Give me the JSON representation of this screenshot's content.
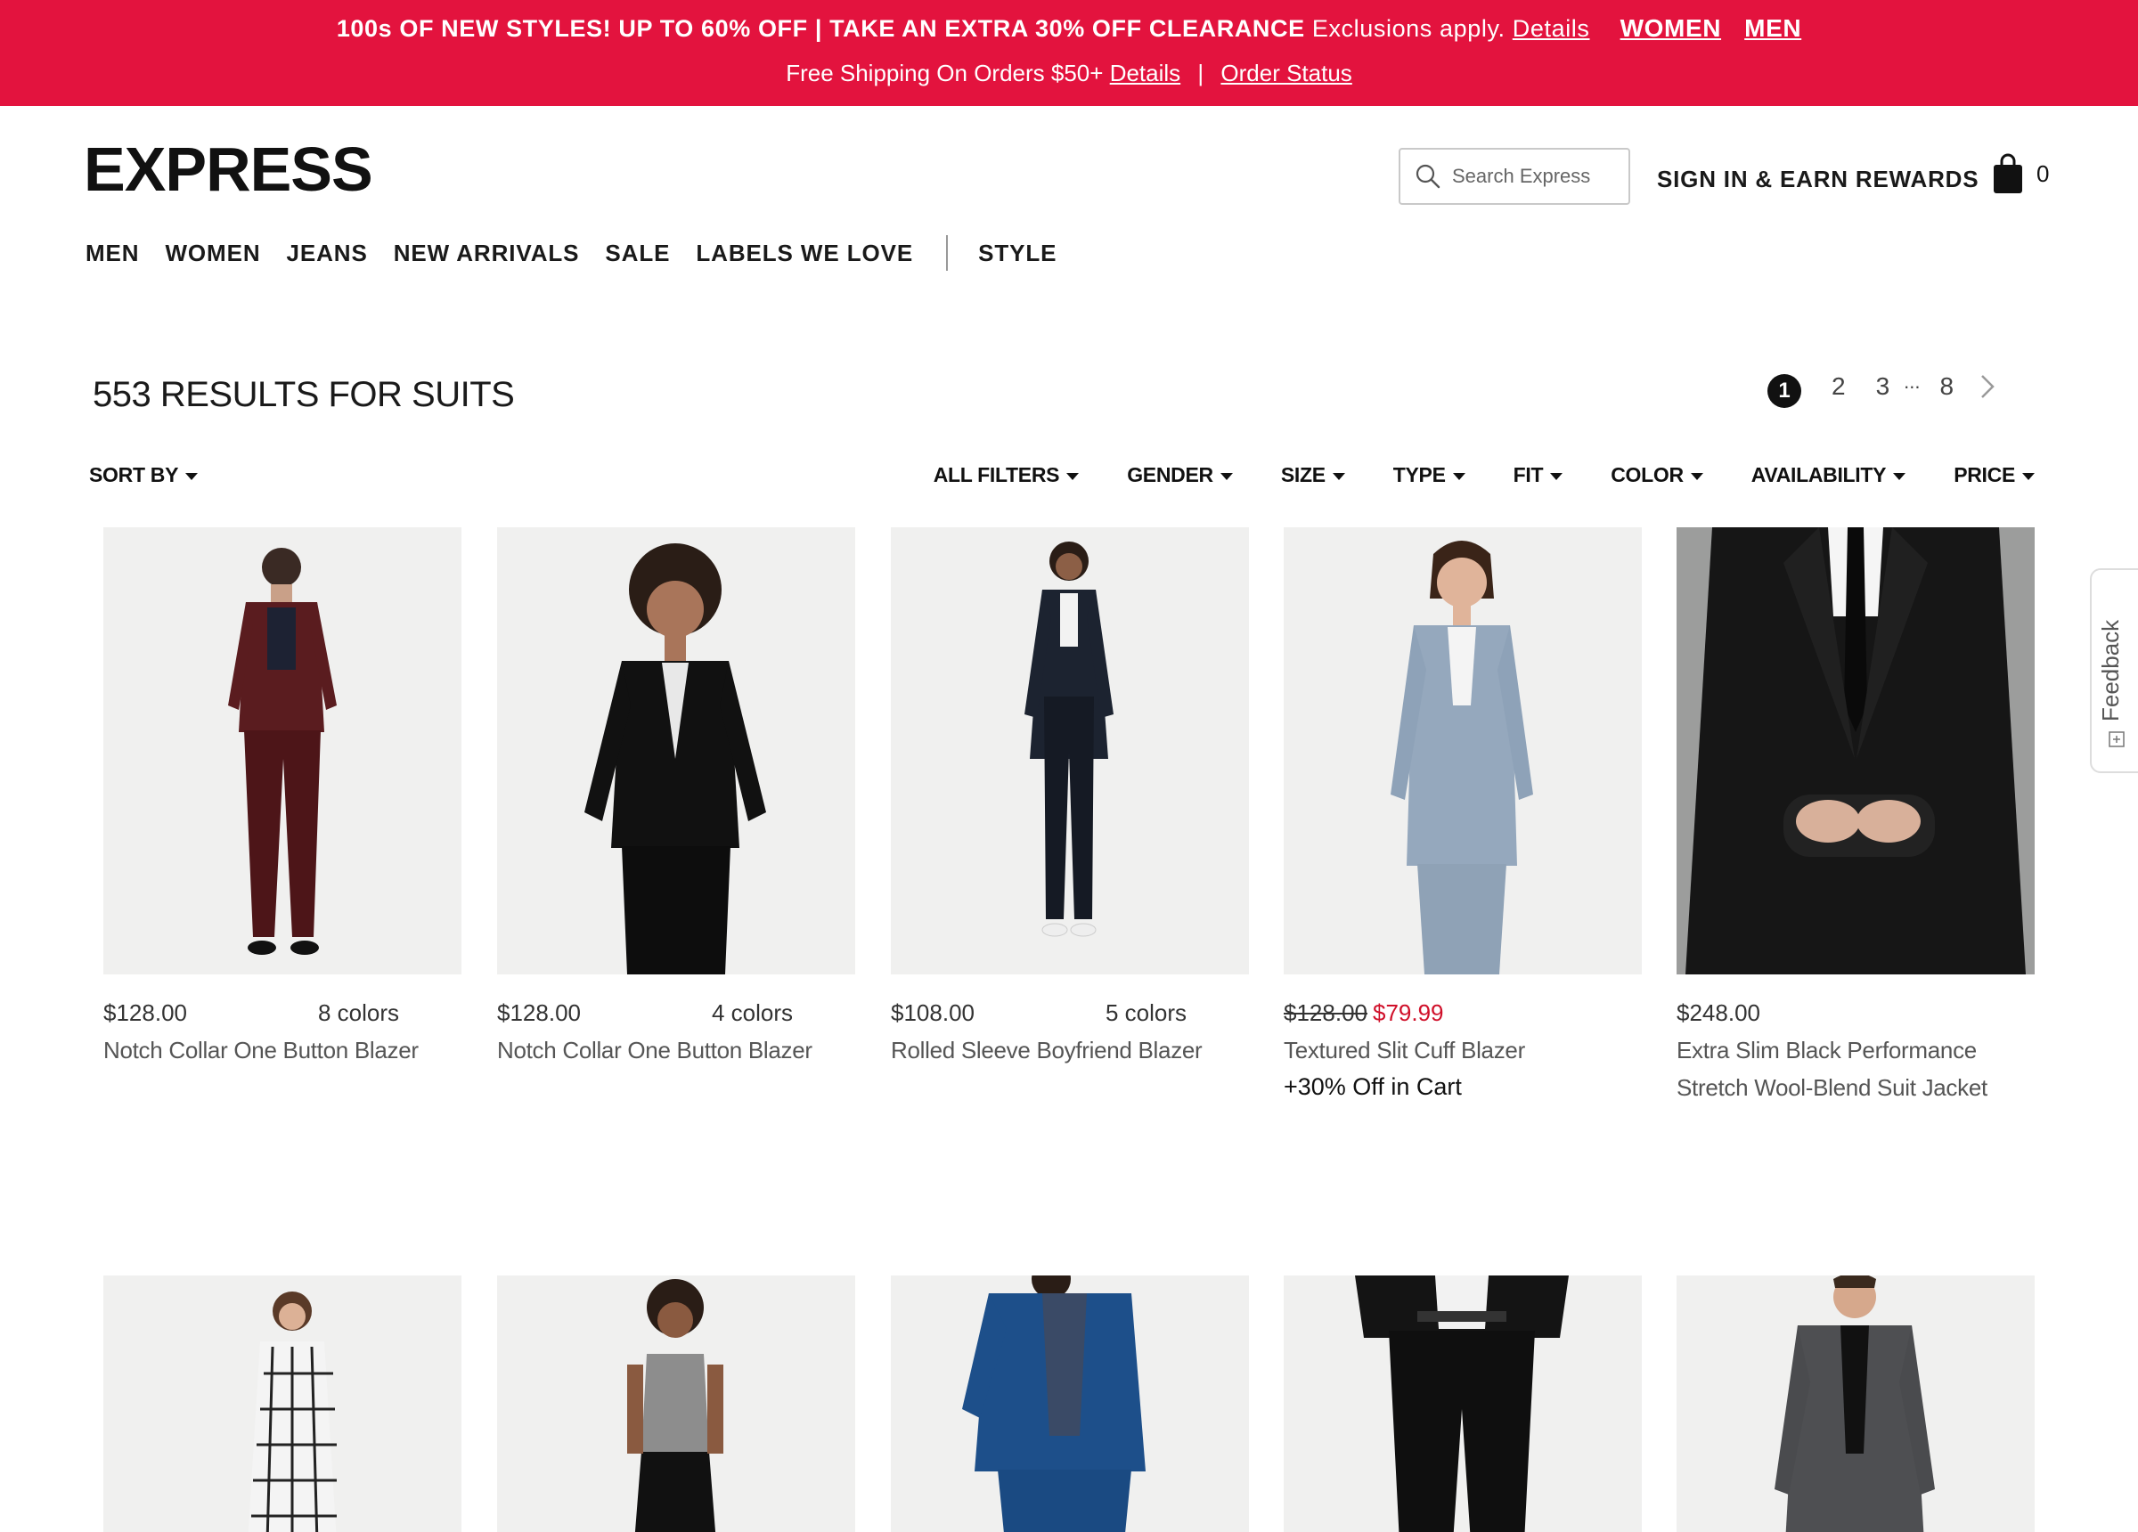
{
  "promo": {
    "headline": "100s OF NEW STYLES! UP TO 60% OFF | TAKE AN EXTRA 30% OFF CLEARANCE",
    "exclusions": "Exclusions apply.",
    "details_link": "Details",
    "women_link": "WOMEN",
    "men_link": "MEN",
    "shipping": "Free Shipping On Orders $50+",
    "shipping_details": "Details",
    "order_status": "Order Status",
    "bg_color": "#e3133e"
  },
  "header": {
    "logo": "EXPRESS",
    "search_placeholder": "Search Express",
    "signin": "SIGN IN & EARN REWARDS",
    "cart_count": "0"
  },
  "nav": {
    "items": [
      "MEN",
      "WOMEN",
      "JEANS",
      "NEW ARRIVALS",
      "SALE",
      "LABELS WE LOVE"
    ],
    "style": "STYLE"
  },
  "results": {
    "title": "553 RESULTS FOR SUITS",
    "pages": {
      "current": "1",
      "p2": "2",
      "p3": "3",
      "ellipsis": "...",
      "last": "8"
    }
  },
  "filters": {
    "sort": "SORT BY",
    "items": [
      "ALL FILTERS",
      "GENDER",
      "SIZE",
      "TYPE",
      "FIT",
      "COLOR",
      "AVAILABILITY",
      "PRICE"
    ]
  },
  "products": [
    {
      "price": "$128.00",
      "colors": "8 colors",
      "name": "Notch Collar One Button Blazer"
    },
    {
      "price": "$128.00",
      "colors": "4 colors",
      "name": "Notch Collar One Button Blazer"
    },
    {
      "price": "$108.00",
      "colors": "5 colors",
      "name": "Rolled Sleeve Boyfriend Blazer"
    },
    {
      "price_old": "$128.00",
      "price_sale": "$79.99",
      "name": "Textured Slit Cuff Blazer",
      "note": "+30% Off in Cart"
    },
    {
      "price": "$248.00",
      "name_line1": "Extra Slim Black Performance",
      "name_line2": "Stretch Wool-Blend Suit Jacket"
    }
  ],
  "feedback": {
    "label": "Feedback"
  }
}
